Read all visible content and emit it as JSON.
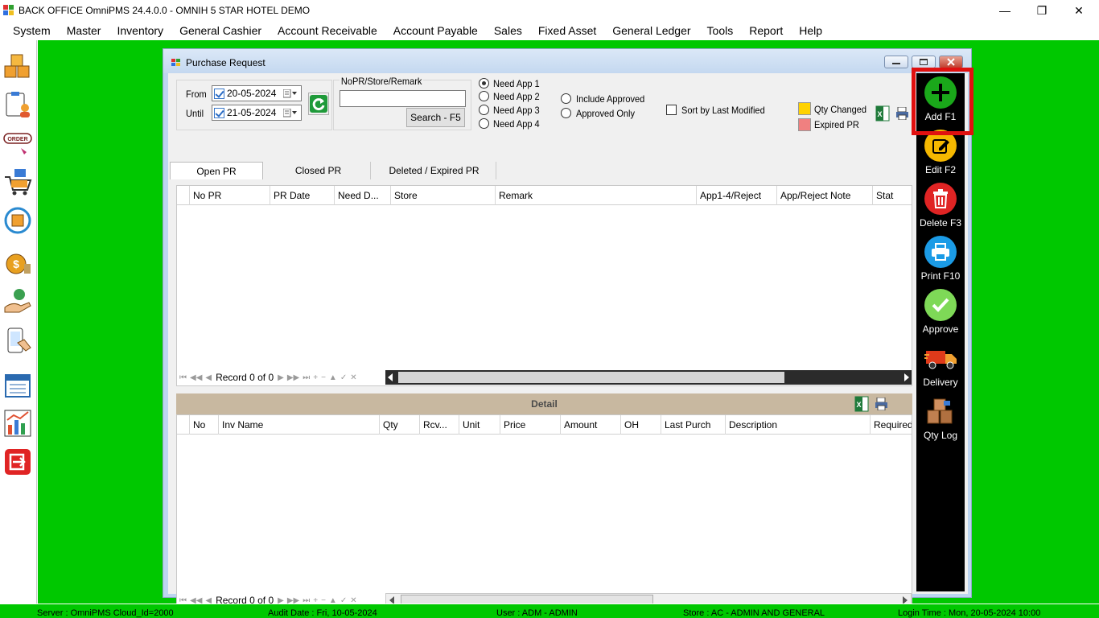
{
  "titlebar": {
    "title": "BACK OFFICE OmniPMS 24.4.0.0 - OMNIH 5 STAR HOTEL DEMO",
    "minimize": "—",
    "restore": "❐",
    "close": "✕"
  },
  "menu": [
    "System",
    "Master",
    "Inventory",
    "General Cashier",
    "Account Receivable",
    "Account Payable",
    "Sales",
    "Fixed Asset",
    "General Ledger",
    "Tools",
    "Report",
    "Help"
  ],
  "left_toolbar": [
    "boxes-icon",
    "clipboard-person-icon",
    "order-icon",
    "cart-icon",
    "refresh-box-icon",
    "money-bag-icon",
    "hand-money-icon",
    "phone-touch-icon",
    "calendar-list-icon",
    "chart-icon",
    "exit-icon"
  ],
  "left_toolbar_order_text": "ORDER",
  "window": {
    "title": "Purchase Request",
    "from_label": "From",
    "until_label": "Until",
    "from_date": "20-05-2024",
    "until_date": "21-05-2024",
    "search_group_label": "NoPR/Store/Remark",
    "search_value": "",
    "search_button": "Search - F5",
    "need_app": [
      {
        "label": "Need App 1",
        "selected": true
      },
      {
        "label": "Need App 2",
        "selected": false
      },
      {
        "label": "Need App 3",
        "selected": false
      },
      {
        "label": "Need App 4",
        "selected": false
      }
    ],
    "include_approved": "Include Approved",
    "approved_only": "Approved Only",
    "sort_last_modified": "Sort by Last Modified",
    "legend_qty_changed": "Qty Changed",
    "legend_expired": "Expired PR",
    "legend_colors": {
      "qty_changed": "#ffd200",
      "expired": "#f08080"
    },
    "tabs": [
      "Open PR",
      "Closed PR",
      "Deleted / Expired PR"
    ],
    "pr_columns": [
      "No PR",
      "PR Date",
      "Need D...",
      "Store",
      "Remark",
      "App1-4/Reject",
      "App/Reject Note",
      "Stat"
    ],
    "record_text": "Record 0 of 0",
    "detail_title": "Detail",
    "detail_columns": [
      "No",
      "Inv Name",
      "Qty",
      "Rcv...",
      "Unit",
      "Price",
      "Amount",
      "OH",
      "Last Purch",
      "Description",
      "Required"
    ],
    "detail_record_text": "Record 0 of 0"
  },
  "actions": [
    {
      "label": "Add F1",
      "color": "#1aa81a",
      "icon": "plus-icon"
    },
    {
      "label": "Edit F2",
      "color": "#f5b800",
      "icon": "edit-icon"
    },
    {
      "label": "Delete F3",
      "color": "#e02424",
      "icon": "trash-icon"
    },
    {
      "label": "Print F10",
      "color": "#1b9be6",
      "icon": "printer-icon"
    },
    {
      "label": "Approve",
      "color": "#7ed957",
      "icon": "check-icon"
    },
    {
      "label": "Delivery",
      "color": "#e03a1a",
      "icon": "truck-icon"
    },
    {
      "label": "Qty Log",
      "color": "#b07040",
      "icon": "boxes-log-icon"
    }
  ],
  "statusbar": {
    "server": "Server : OmniPMS Cloud_Id=2000",
    "audit": "Audit Date : Fri, 10-05-2024",
    "user": "User : ADM - ADMIN",
    "store": "Store : AC - ADMIN AND GENERAL",
    "login": "Login Time : Mon, 20-05-2024 10:00"
  },
  "nav_glyphs": [
    "⏮",
    "◀◀",
    "◀",
    "▶",
    "▶▶",
    "⏭",
    "+",
    "−",
    "▲",
    "✓",
    "✕"
  ]
}
